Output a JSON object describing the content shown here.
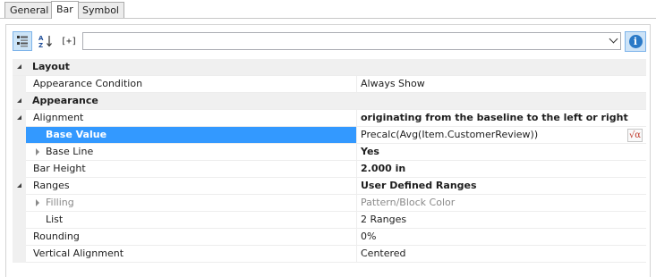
{
  "tabs": [
    "General",
    "Bar",
    "Symbol"
  ],
  "toolbar": {
    "categorized_icon": "categorized-view-icon",
    "sort_icon": "sort-az-icon",
    "expand_label": "[+]",
    "filter_value": "",
    "info_label": "i"
  },
  "grid": {
    "layout": {
      "label": "Layout",
      "appearance_condition": {
        "name": "Appearance Condition",
        "value": "Always Show"
      }
    },
    "appearance": {
      "label": "Appearance",
      "alignment": {
        "name": "Alignment",
        "value": "originating from the baseline to the left or right"
      },
      "base_value": {
        "name": "Base Value",
        "value": "Precalc(Avg(Item.CustomerReview))",
        "formula_icon": "√α"
      },
      "base_line": {
        "name": "Base Line",
        "value": "Yes"
      },
      "bar_height": {
        "name": "Bar Height",
        "value": "2.000 in"
      },
      "ranges": {
        "name": "Ranges",
        "value": "User Defined Ranges"
      },
      "filling": {
        "name": "Filling",
        "value": "Pattern/Block Color"
      },
      "list": {
        "name": "List",
        "value": "2 Ranges"
      },
      "rounding": {
        "name": "Rounding",
        "value": "0%"
      },
      "vertical_alignment": {
        "name": "Vertical Alignment",
        "value": "Centered"
      }
    }
  },
  "colors": {
    "selection": "#3399ff",
    "accent": "#2a79c7",
    "formula": "#c0392b"
  }
}
